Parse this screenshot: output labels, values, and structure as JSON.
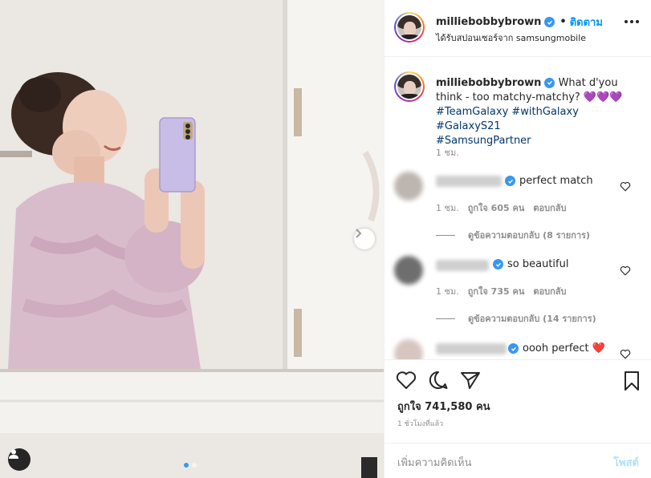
{
  "post": {
    "username": "milliebobbybrown",
    "follow_label": "ติดตาม",
    "separator": "•",
    "sponsor_text": "ได้รับสปอนเซอร์จาก samsungmobile",
    "caption_text": "What d'you think - too matchy-matchy? 💜💜💜",
    "hashtags": [
      "#TeamGalaxy",
      "#withGalaxy",
      "#GalaxyS21",
      "#SamsungPartner"
    ],
    "caption_time": "1 ชม."
  },
  "comments": [
    {
      "text": "perfect match",
      "time": "1 ชม.",
      "likes": "ถูกใจ 605 คน",
      "reply": "ตอบกลับ",
      "view_replies": "ดูข้อความตอบกลับ (8 รายการ)"
    },
    {
      "text": "so beautiful",
      "time": "1 ชม.",
      "likes": "ถูกใจ 735 คน",
      "reply": "ตอบกลับ",
      "view_replies": "ดูข้อความตอบกลับ (14 รายการ)"
    },
    {
      "text": "oooh perfect ❤️",
      "time": "",
      "likes": "",
      "reply": "",
      "view_replies": ""
    }
  ],
  "actions": {
    "likes_label": "ถูกใจ 741,580 คน",
    "posted_ago": "1 ชั่วโมงที่แล้ว"
  },
  "composer": {
    "placeholder": "เพิ่มความคิดเห็น",
    "post_label": "โพสต์"
  },
  "colors": {
    "link_blue": "#0095f6",
    "hashtag": "#00376b",
    "muted": "#8e8e8e",
    "verified": "#3897f0"
  },
  "carousel": {
    "total": 2,
    "current": 1
  }
}
